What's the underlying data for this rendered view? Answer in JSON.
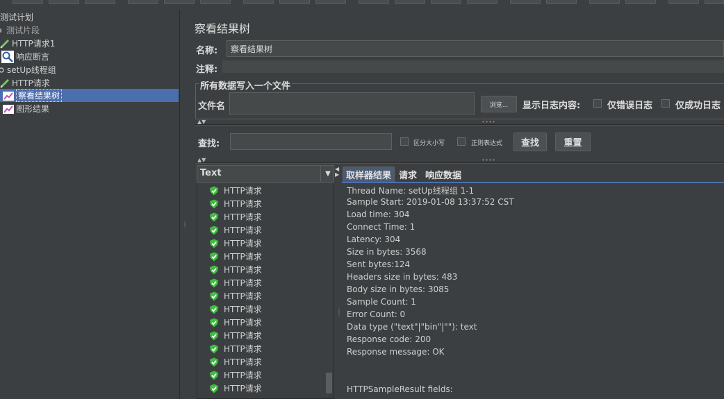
{
  "tree": {
    "items": [
      {
        "label": "测试计划",
        "icon": "test-plan-icon",
        "depth": 0
      },
      {
        "label": "测试片段",
        "icon": "test-fragment-icon",
        "depth": 0
      },
      {
        "label": "HTTP请求1",
        "icon": "sampler-pen-icon",
        "depth": 0
      },
      {
        "label": "响应断言",
        "icon": "assertion-magnifier-icon",
        "depth": 1
      },
      {
        "label": "setUp线程组",
        "icon": "thread-group-gear-icon",
        "depth": 0
      },
      {
        "label": "HTTP请求",
        "icon": "sampler-pen-icon",
        "depth": 0
      },
      {
        "label": "察看结果树",
        "icon": "listener-chart-icon",
        "depth": 1,
        "selected": true
      },
      {
        "label": "图形结果",
        "icon": "listener-chart-icon",
        "depth": 1
      }
    ]
  },
  "panel": {
    "title": "察看结果树",
    "name_label": "名称:",
    "name_value": "察看结果树",
    "comment_label": "注释:",
    "file_group_title": "所有数据写入一个文件",
    "filename_label": "文件名",
    "browse_label": "浏览...",
    "log_label": "显示日志内容:",
    "errors_only_label": "仅错误日志",
    "success_only_label": "仅成功日志",
    "search_label": "查找:",
    "case_label": "区分大小写",
    "regex_label": "正则表达式",
    "find_button": "查找",
    "reset_button": "重置"
  },
  "renderer": {
    "selected": "Text"
  },
  "samples": [
    "HTTP请求",
    "HTTP请求",
    "HTTP请求",
    "HTTP请求",
    "HTTP请求",
    "HTTP请求",
    "HTTP请求",
    "HTTP请求",
    "HTTP请求",
    "HTTP请求",
    "HTTP请求",
    "HTTP请求",
    "HTTP请求",
    "HTTP请求",
    "HTTP请求",
    "HTTP请求"
  ],
  "tabs": [
    {
      "label": "取样器结果",
      "active": true
    },
    {
      "label": "请求",
      "active": false
    },
    {
      "label": "响应数据",
      "active": false
    }
  ],
  "result_lines": [
    "Thread Name: setUp线程组 1-1",
    "Sample Start: 2019-01-08 13:37:52 CST",
    "Load time: 304",
    "Connect Time: 1",
    "Latency: 304",
    "Size in bytes: 3568",
    "Sent bytes:124",
    "Headers size in bytes: 483",
    "Body size in bytes: 3085",
    "Sample Count: 1",
    "Error Count: 0",
    "Data type (\"text\"|\"bin\"|\"\"): text",
    "Response code: 200",
    "Response message: OK",
    "",
    "",
    "HTTPSampleResult fields:"
  ],
  "colors": {
    "background": "#3c3f41",
    "selection": "#4b6eaf",
    "success_green": "#3fbf3f"
  }
}
